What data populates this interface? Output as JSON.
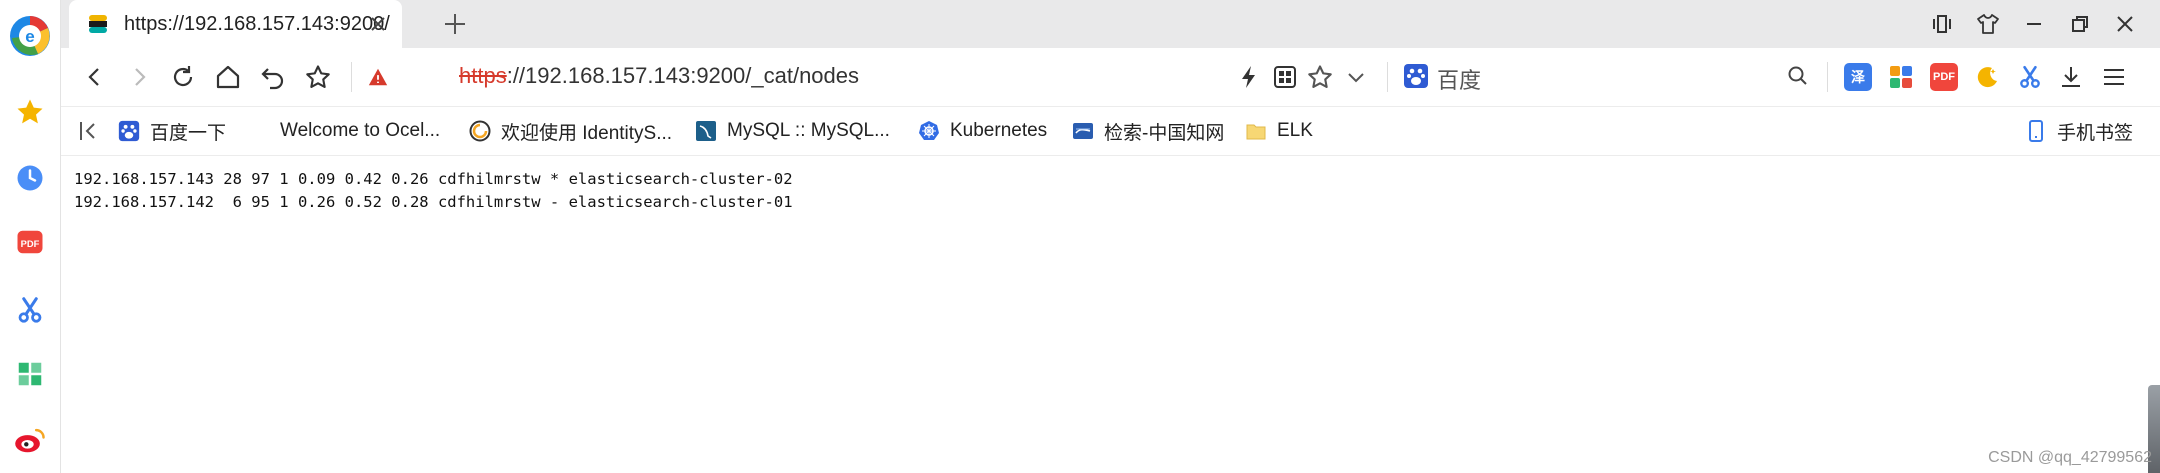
{
  "tab": {
    "title": "https://192.168.157.143:9200/"
  },
  "address": {
    "scheme": "https",
    "rest": "://192.168.157.143:9200/_cat/nodes"
  },
  "search": {
    "engine_label": "百度"
  },
  "extensions": {
    "translate": "泽",
    "pdf": "PDF"
  },
  "bookmarks": [
    {
      "label": "百度一下",
      "icon": "baidu-paw-icon"
    },
    {
      "label": "Welcome to Ocel...",
      "icon": "blank-page-icon"
    },
    {
      "label": "欢迎使用 IdentityS...",
      "icon": "identity-icon"
    },
    {
      "label": "MySQL :: MySQL...",
      "icon": "mysql-icon"
    },
    {
      "label": "Kubernetes",
      "icon": "kubernetes-icon"
    },
    {
      "label": "检索-中国知网",
      "icon": "cnki-icon"
    },
    {
      "label": "ELK",
      "icon": "folder-icon"
    }
  ],
  "mobile_bookmarks": "手机书签",
  "content": {
    "lines": [
      "192.168.157.143 28 97 1 0.09 0.42 0.26 cdfhilmrstw * elasticsearch-cluster-02",
      "192.168.157.142  6 95 1 0.26 0.52 0.28 cdfhilmrstw - elasticsearch-cluster-01"
    ]
  },
  "watermark": "CSDN @qq_42799562",
  "colors": {
    "accent_blue": "#1a73e8",
    "https_red": "#d63a2c",
    "titlebar_bg": "#e9e9ea"
  }
}
